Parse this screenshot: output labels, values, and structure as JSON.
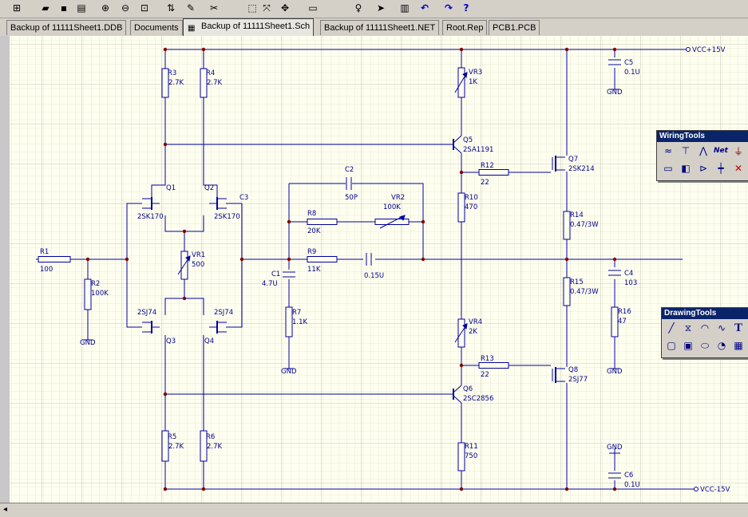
{
  "tabs": [
    {
      "label": "Backup of 11111Sheet1.DDB",
      "active": false
    },
    {
      "label": "Documents",
      "active": false
    },
    {
      "label": "Backup of 11111Sheet1.Sch",
      "active": true
    },
    {
      "label": "Backup of 11111Sheet1.NET",
      "active": false
    },
    {
      "label": "Root.Rep",
      "active": false
    },
    {
      "label": "PCB1.PCB",
      "active": false
    }
  ],
  "toolbar_icons": [
    "hierarchy-icon",
    "open-folder-icon",
    "save-icon",
    "print-icon",
    "zoom-in-icon",
    "zoom-out-icon",
    "zoom-fit-icon",
    "up-down-icon",
    "pencil-icon",
    "wire-cross-icon",
    "select-area-icon",
    "deselect-icon",
    "move-icon",
    "component-icon",
    "probe-icon",
    "run-icon",
    "library-icon",
    "undo-icon",
    "redo-icon",
    "help-icon"
  ],
  "panels": {
    "wiring": {
      "title": "WiringTools",
      "net_label": "Net"
    },
    "drawing": {
      "title": "DrawingTools",
      "text_tool": "T"
    }
  },
  "schematic": {
    "components": [
      {
        "ref": "R1",
        "value": "100"
      },
      {
        "ref": "R2",
        "value": "100K"
      },
      {
        "ref": "R3",
        "value": "2.7K"
      },
      {
        "ref": "R4",
        "value": "2.7K"
      },
      {
        "ref": "R5",
        "value": "2.7K"
      },
      {
        "ref": "R6",
        "value": "2.7K"
      },
      {
        "ref": "R7",
        "value": "1.1K"
      },
      {
        "ref": "R8",
        "value": "20K"
      },
      {
        "ref": "R9",
        "value": "11K"
      },
      {
        "ref": "R10",
        "value": "470"
      },
      {
        "ref": "R11",
        "value": "750"
      },
      {
        "ref": "R12",
        "value": "22"
      },
      {
        "ref": "R13",
        "value": "22"
      },
      {
        "ref": "R14",
        "value": "0.47/3W"
      },
      {
        "ref": "R15",
        "value": "0.47/3W"
      },
      {
        "ref": "R16",
        "value": "47"
      },
      {
        "ref": "C1",
        "value": "4.7U"
      },
      {
        "ref": "C2",
        "value": "50P"
      },
      {
        "ref": "C4",
        "value": "103"
      },
      {
        "ref": "C5",
        "value": "0.1U"
      },
      {
        "ref": "C6",
        "value": "0.1U"
      },
      {
        "ref": "VR1",
        "value": "500"
      },
      {
        "ref": "VR2",
        "value": "100K"
      },
      {
        "ref": "VR3",
        "value": "1K"
      },
      {
        "ref": "VR4",
        "value": "2K"
      },
      {
        "ref": "Q1",
        "value": "2SK170"
      },
      {
        "ref": "Q2",
        "value": "2SK170"
      },
      {
        "ref": "Q3",
        "value": "2SJ74"
      },
      {
        "ref": "Q4",
        "value": "2SJ74"
      },
      {
        "ref": "Q5",
        "value": "2SA1191"
      },
      {
        "ref": "Q6",
        "value": "2SC2856"
      },
      {
        "ref": "Q7",
        "value": "2SK214"
      },
      {
        "ref": "Q8",
        "value": "2SJ77"
      }
    ],
    "labels": {
      "c3": "C3",
      "c9_value": "0.15U",
      "vcc_pos": "VCC+15V",
      "vcc_neg": "VCC-15V",
      "gnd": "GND"
    }
  }
}
